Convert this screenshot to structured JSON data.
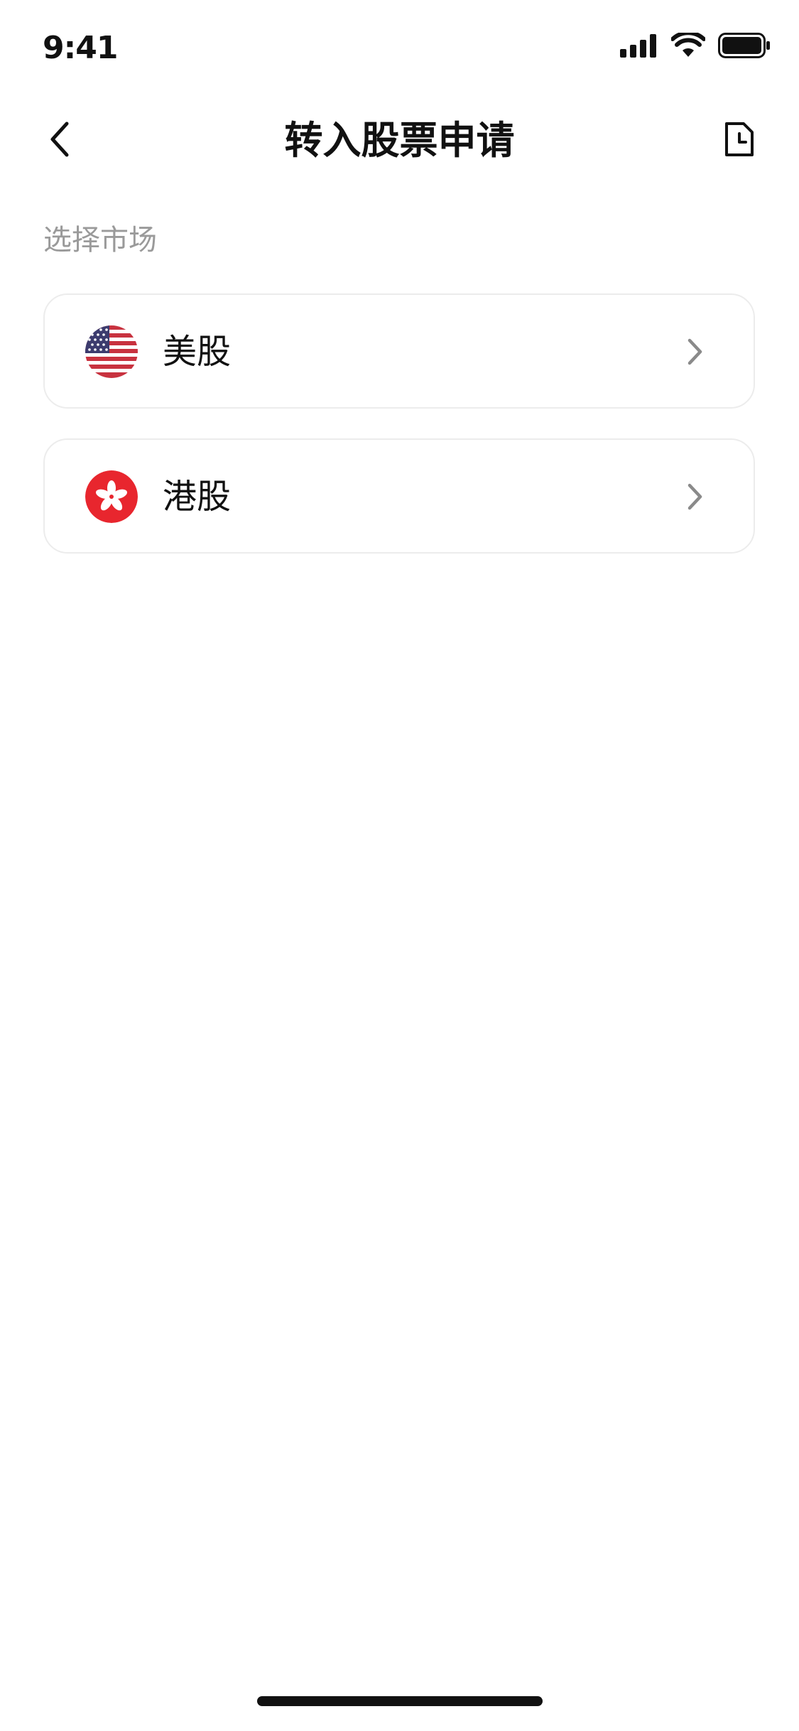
{
  "status_bar": {
    "time": "9:41",
    "icons": [
      "cellular-signal-icon",
      "wifi-icon",
      "battery-icon"
    ]
  },
  "nav": {
    "title": "转入股票申请",
    "back_icon": "chevron-left-icon",
    "history_icon": "document-clock-icon"
  },
  "section": {
    "label": "选择市场"
  },
  "markets": [
    {
      "name": "美股",
      "flag_icon": "us-flag-icon",
      "chevron_icon": "chevron-right-icon"
    },
    {
      "name": "港股",
      "flag_icon": "hk-flag-icon",
      "chevron_icon": "chevron-right-icon"
    }
  ],
  "colors": {
    "text_primary": "#111111",
    "text_secondary": "#9a9a9a",
    "card_border": "#ececec",
    "chevron": "#8a8a8a",
    "us_red": "#c8323f",
    "us_blue": "#3c3b6e",
    "hk_red": "#e8262e"
  }
}
